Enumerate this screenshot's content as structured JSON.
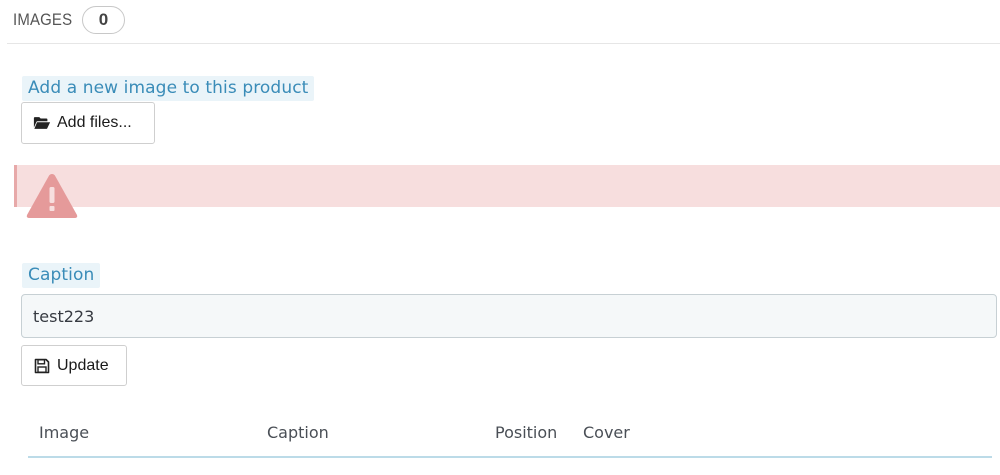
{
  "panel": {
    "title": "IMAGES",
    "count": "0"
  },
  "upload": {
    "label": "Add a new image to this product",
    "add_files_button": "Add files...",
    "add_files_icon": "folder-open-icon"
  },
  "alert": {
    "icon": "warning-triangle-icon",
    "background_color": "#f7dede",
    "icon_color": "#e59a9a"
  },
  "caption": {
    "label": "Caption",
    "value": "test223",
    "update_button": "Update",
    "update_icon": "floppy-disk-icon"
  },
  "table": {
    "columns": [
      "Image",
      "Caption",
      "Position",
      "Cover"
    ]
  },
  "colors": {
    "label_text": "#3a8cb8",
    "label_bg": "#eaf4f9",
    "table_border": "#bcdbe8"
  }
}
